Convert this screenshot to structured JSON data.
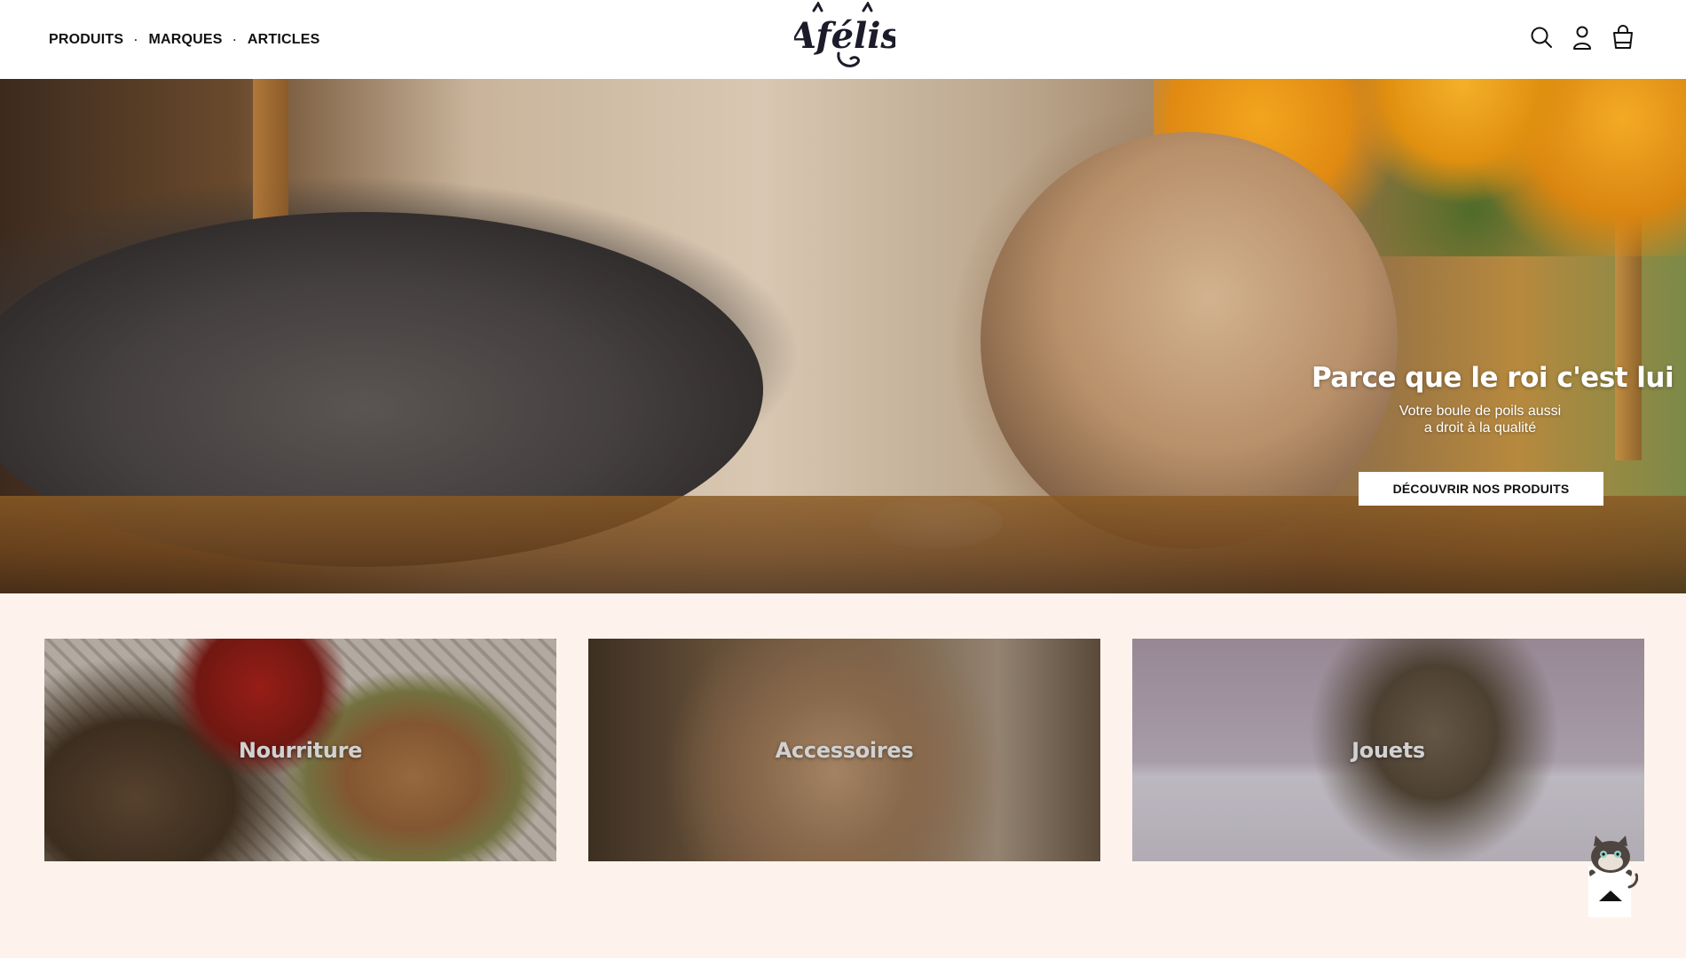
{
  "header": {
    "nav": [
      {
        "label": "PRODUITS"
      },
      {
        "label": "MARQUES"
      },
      {
        "label": "ARTICLES"
      }
    ],
    "separator": "·",
    "logo_text": "Afélis",
    "icons": [
      "search-icon",
      "account-icon",
      "cart-icon"
    ]
  },
  "hero": {
    "title": "Parce que le roi c'est lui",
    "subtitle_line1": "Votre boule de poils aussi",
    "subtitle_line2": "a droit à la qualité",
    "cta": "DÉCOUVRIR NOS PRODUITS"
  },
  "categories": [
    {
      "label": "Nourriture"
    },
    {
      "label": "Accessoires"
    },
    {
      "label": "Jouets"
    }
  ],
  "back_to_top": {
    "icon": "back-to-top-cat-icon"
  },
  "colors": {
    "page_bg": "#fdf3ec",
    "header_bg": "#ffffff",
    "text": "#111111",
    "cta_bg": "#ffffff"
  }
}
